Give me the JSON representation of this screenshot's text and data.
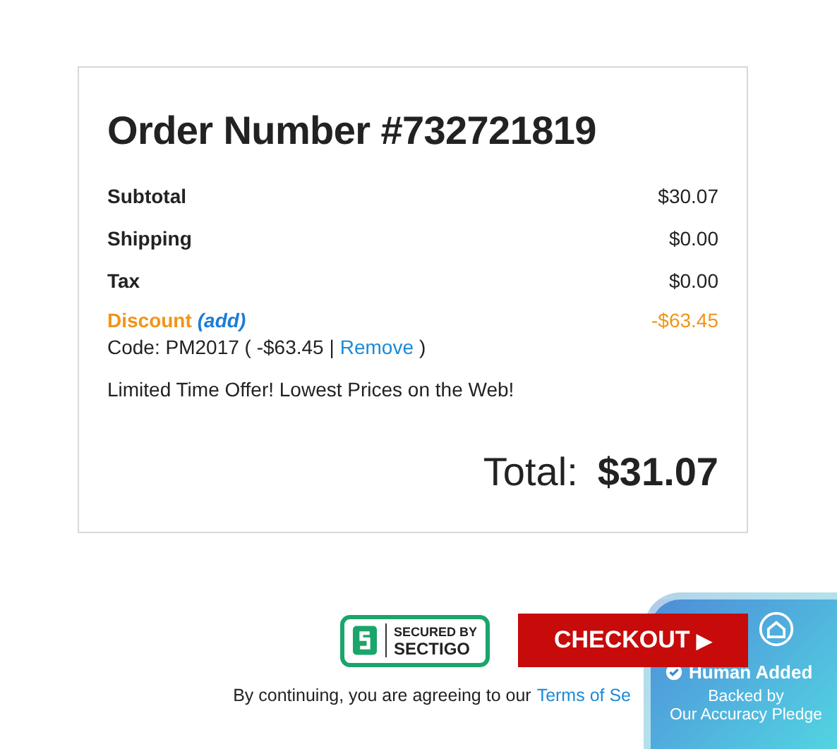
{
  "order": {
    "title": "Order Number #732721819",
    "lines": [
      {
        "label": "Subtotal",
        "value": "$30.07"
      },
      {
        "label": "Shipping",
        "value": "$0.00"
      },
      {
        "label": "Tax",
        "value": "$0.00"
      }
    ],
    "discount": {
      "label": "Discount",
      "add_link": "(add)",
      "value": "-$63.45",
      "code_text": "Code: PM2017 ( -$63.45 |",
      "remove_link": "Remove",
      "close_paren": ")"
    },
    "offer": "Limited Time Offer! Lowest Prices on the Web!",
    "total_label": "Total:",
    "total_value": "$31.07"
  },
  "seal": {
    "line_1": "SECURED BY",
    "line_2": "SECTIGO"
  },
  "checkout_button": {
    "label": "CHECKOUT",
    "arrow": "▶"
  },
  "agreement": {
    "text": "By continuing, you are agreeing to our",
    "link": "Terms of Se"
  },
  "badge": {
    "title": "Human Added",
    "subtitle_1": "Backed by",
    "subtitle_2": "Our Accuracy Pledge"
  }
}
